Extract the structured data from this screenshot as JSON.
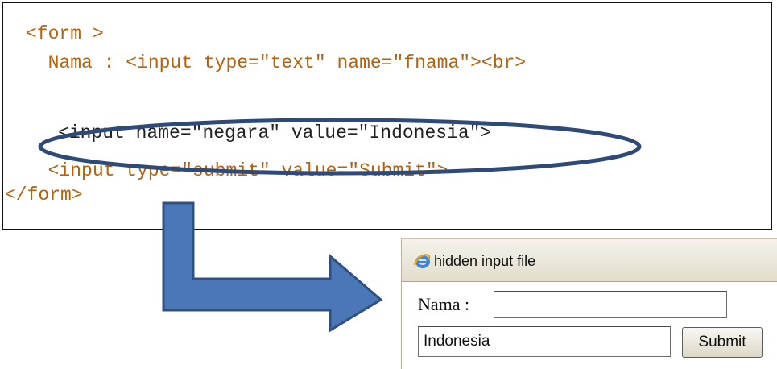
{
  "code": {
    "line1": "<form >",
    "line2": "  Nama : <input type=\"text\" name=\"fnama\"><br>",
    "line3_open": "<",
    "line3_rest": "input name=\"negara\" value=\"Indonesia\">",
    "line4": "  <input type=\"submit\" value=\"Submit\">",
    "line5": "</form>"
  },
  "preview": {
    "window_title": "hidden input file",
    "icon": "internet-explorer-icon",
    "nama_label": "Nama :",
    "fnama_value": "",
    "negara_value": "Indonesia",
    "submit_label": "Submit"
  },
  "colors": {
    "code_text": "#b5620a",
    "highlight_ellipse": "#2e4a78",
    "arrow_fill": "#4a77b8",
    "arrow_stroke": "#2f5080"
  }
}
